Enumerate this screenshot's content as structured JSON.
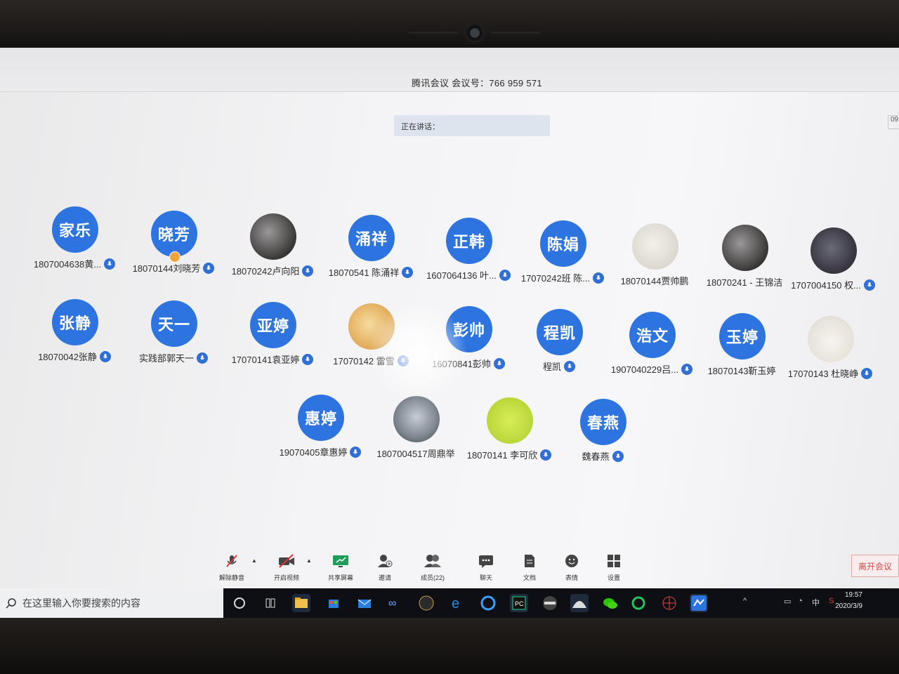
{
  "window": {
    "title": "腾讯会议 会议号：766 959 571"
  },
  "speaking": {
    "label": "正在讲话："
  },
  "corner_number": "09",
  "participants": [
    {
      "avatar_text": "家乐",
      "name": "1807004638黄...",
      "avatar": "blue"
    },
    {
      "avatar_text": "晓芳",
      "name": "18070144刘晓芳",
      "avatar": "blue"
    },
    {
      "avatar_text": "",
      "name": "18070242卢向阳",
      "avatar": "photo"
    },
    {
      "avatar_text": "涌祥",
      "name": "18070541 陈涌祥",
      "avatar": "blue"
    },
    {
      "avatar_text": "正韩",
      "name": "1607064136 叶...",
      "avatar": "blue"
    },
    {
      "avatar_text": "陈娟",
      "name": "17070242班 陈...",
      "avatar": "blue"
    },
    {
      "avatar_text": "",
      "name": "18070144贾帅鹏",
      "avatar": "photo-light"
    },
    {
      "avatar_text": "",
      "name": "18070241 - 王锦洁",
      "avatar": "photo"
    },
    {
      "avatar_text": "",
      "name": "1707004150 权...",
      "avatar": "photo-girl"
    },
    {
      "avatar_text": "张静",
      "name": "18070042张静",
      "avatar": "blue"
    },
    {
      "avatar_text": "天一",
      "name": "实践部郭天一",
      "avatar": "blue"
    },
    {
      "avatar_text": "亚婷",
      "name": "17070141袁亚婷",
      "avatar": "blue"
    },
    {
      "avatar_text": "",
      "name": "17070142 雷雪",
      "avatar": "photo-pudding"
    },
    {
      "avatar_text": "彭帅",
      "name": "16070841彭帅",
      "avatar": "blue"
    },
    {
      "avatar_text": "程凯",
      "name": "程凯",
      "avatar": "blue"
    },
    {
      "avatar_text": "浩文",
      "name": "1907040229吕...",
      "avatar": "blue"
    },
    {
      "avatar_text": "玉婷",
      "name": "18070143靳玉婷",
      "avatar": "blue"
    },
    {
      "avatar_text": "",
      "name": "17070143 杜晓峥",
      "avatar": "photo-dog"
    },
    {
      "avatar_text": "惠婷",
      "name": "19070405章惠婷",
      "avatar": "blue"
    },
    {
      "avatar_text": "",
      "name": "1807004517周鼎举",
      "avatar": "photo-anime"
    },
    {
      "avatar_text": "",
      "name": "18070141 李可欣",
      "avatar": "photo-blob"
    },
    {
      "avatar_text": "春燕",
      "name": "魏春燕",
      "avatar": "blue"
    }
  ],
  "toolbar": {
    "unmute": "解除静音",
    "start_video": "开启视频",
    "share_screen": "共享屏幕",
    "invite": "邀请",
    "members": "成员(22)",
    "chat": "聊天",
    "docs": "文档",
    "reactions": "表情",
    "settings": "设置"
  },
  "leave_button": "离开会议",
  "taskbar": {
    "search_placeholder": "在这里输入你要搜索的内容",
    "time": "19:57",
    "date": "2020/3/9",
    "ime": "中"
  },
  "colors": {
    "accent": "#2e74e0",
    "leave": "#d24b4b"
  }
}
